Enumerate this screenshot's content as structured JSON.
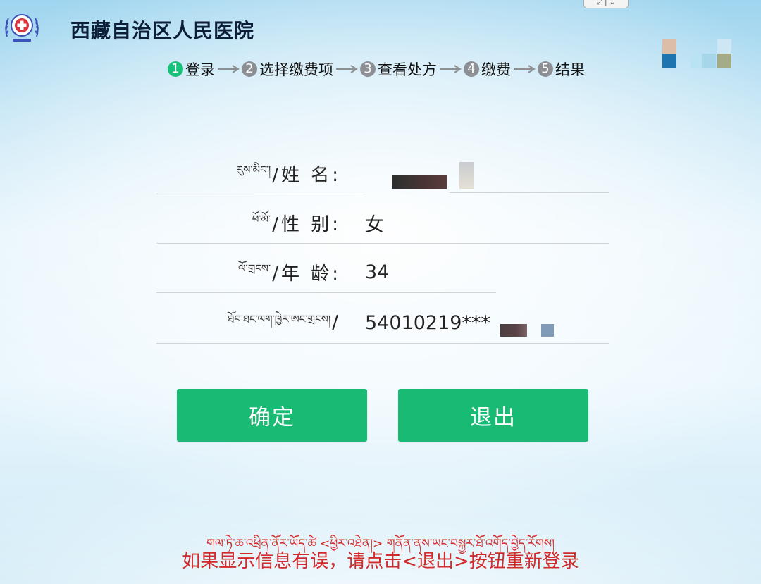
{
  "header": {
    "hospital_name": "西藏自治区人民医院"
  },
  "steps": [
    {
      "num": "1",
      "label": "登录",
      "active": true
    },
    {
      "num": "2",
      "label": "选择缴费项",
      "active": false
    },
    {
      "num": "3",
      "label": "查看处方",
      "active": false
    },
    {
      "num": "4",
      "label": "缴费",
      "active": false
    },
    {
      "num": "5",
      "label": "结果",
      "active": false
    }
  ],
  "form": {
    "name": {
      "label_tib": "རུས་མིང་།",
      "label_cn": "/姓 名:",
      "value": ""
    },
    "gender": {
      "label_tib": "ཕོ་མོ་",
      "label_cn": "/性 别:",
      "value": "女"
    },
    "age": {
      "label_tib": "ལོ་གྲངས་",
      "label_cn": "/年 龄:",
      "value": "34"
    },
    "id_number": {
      "label_tib": "ཐོབ་ཐང་ལག་ཁྱེར་ཨང་གྲངས།",
      "label_cn": "/",
      "value": "54010219***"
    }
  },
  "buttons": {
    "confirm": "确定",
    "exit": "退出"
  },
  "notice": {
    "tibetan": "གལ་ཏེ་ཆ་འཕྲིན་ནོར་ཡོད་ཚེ <ཕྱིར་འཐེན།> གནོན་ནས་ཡང་བསྐྱར་ཐོ་འགོད་བྱེད་རོགས།",
    "chinese": "如果显示信息有误，请点击<退出>按钮重新登录"
  },
  "colors": {
    "primary_button": "#19bb74",
    "active_step": "#17c17a",
    "inactive_step": "#8c8f93",
    "notice_text": "#d12a2a"
  },
  "icons": {
    "logo": "hospital-emblem-icon",
    "step_arrow": "arrow-right-icon"
  }
}
